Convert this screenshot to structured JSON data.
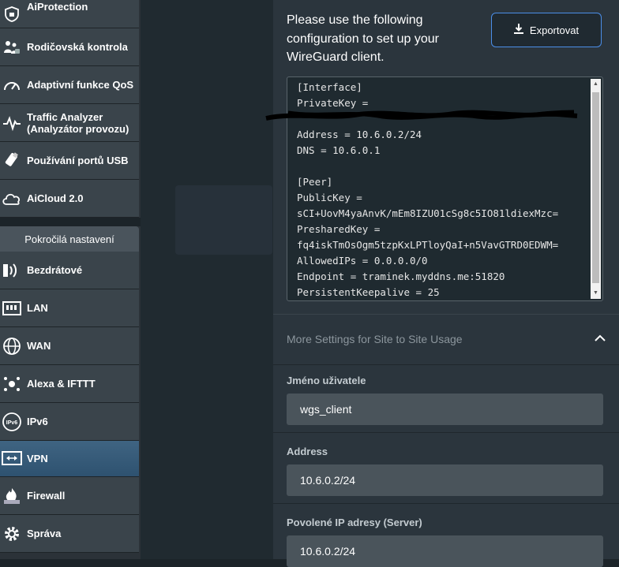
{
  "sidebar": {
    "top_items": [
      {
        "label": "AiProtection",
        "icon": "shield-icon"
      },
      {
        "label": "Rodičovská kontrola",
        "icon": "parental-control-icon"
      },
      {
        "label": "Adaptivní funkce QoS",
        "icon": "gauge-icon"
      },
      {
        "label": "Traffic Analyzer (Analyzátor provozu)",
        "icon": "pulse-icon"
      },
      {
        "label": "Používání portů USB",
        "icon": "usb-icon"
      },
      {
        "label": "AiCloud 2.0",
        "icon": "cloud-icon"
      }
    ],
    "section_title": "Pokročilá nastavení",
    "adv_items": [
      {
        "label": "Bezdrátové",
        "icon": "wifi-icon"
      },
      {
        "label": "LAN",
        "icon": "lan-icon"
      },
      {
        "label": "WAN",
        "icon": "globe-icon"
      },
      {
        "label": "Alexa & IFTTT",
        "icon": "alexa-icon"
      },
      {
        "label": "IPv6",
        "icon": "ipv6-icon"
      },
      {
        "label": "VPN",
        "icon": "vpn-icon"
      },
      {
        "label": "Firewall",
        "icon": "firewall-icon"
      },
      {
        "label": "Správa",
        "icon": "gear-icon"
      }
    ],
    "active": "VPN"
  },
  "panel": {
    "intro": "Please use the following configuration to set up your WireGuard client.",
    "export_label": "Exportovat",
    "config_lines": [
      "[Interface]",
      "PrivateKey =",
      "",
      "Address = 10.6.0.2/24",
      "DNS = 10.6.0.1",
      "",
      "[Peer]",
      "PublicKey =",
      "sCI+UovM4yaAnvK/mEm8IZU01cSg8c5IO81ldiexMzc=",
      "PresharedKey =",
      "fq4iskTmOsOgm5tzpKxLPTloyQaI+n5VavGTRD0EDWM=",
      "AllowedIPs = 0.0.0.0/0",
      "Endpoint = traminek.myddns.me:51820",
      "PersistentKeepalive = 25"
    ],
    "more_settings": "More Settings for Site to Site Usage",
    "fields": [
      {
        "label": "Jméno uživatele",
        "value": "wgs_client"
      },
      {
        "label": "Address",
        "value": "10.6.0.2/24"
      },
      {
        "label": "Povolené IP adresy (Server)",
        "value": "10.6.0.2/24"
      }
    ]
  }
}
